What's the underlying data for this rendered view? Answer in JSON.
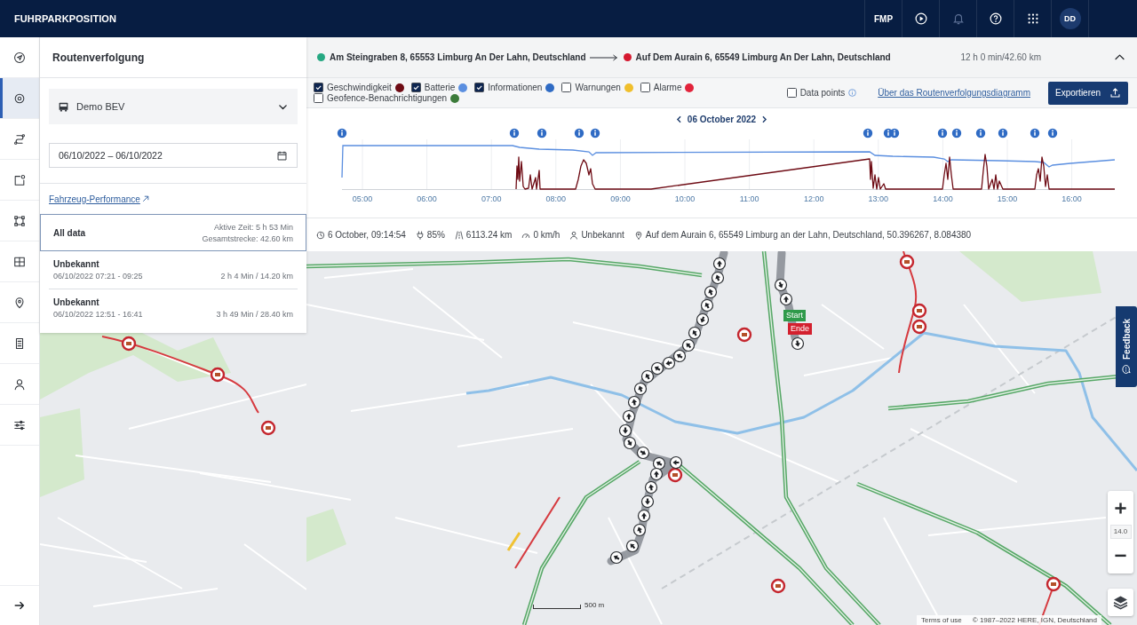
{
  "top_bar": {
    "logo": "FUHRPARKPOSITION",
    "account": "FMP",
    "avatar": "DD"
  },
  "nav_rail": {
    "items": [
      {
        "selected": false
      },
      {
        "selected": true
      },
      {
        "selected": false
      },
      {
        "selected": false
      },
      {
        "selected": false
      },
      {
        "selected": false
      },
      {
        "selected": false
      },
      {
        "selected": false
      },
      {
        "selected": false
      },
      {
        "selected": false
      }
    ]
  },
  "panel": {
    "title": "Routenverfolgung",
    "vehicle": "Demo BEV",
    "date_range": "06/10/2022 – 06/10/2022",
    "performance_link": "Fahrzeug-Performance",
    "trips": [
      {
        "kind": "summary",
        "title": "All data",
        "lines": [
          "Aktive Zeit: 5 h 53 Min",
          "Gesamtstrecke: 42.60 km"
        ],
        "selected": true
      },
      {
        "kind": "trip",
        "title": "Unbekannt",
        "period": "06/10/2022 07:21 - 09:25",
        "summary": "2 h 4 Min / 14.20 km",
        "selected": false
      },
      {
        "kind": "trip",
        "title": "Unbekannt",
        "period": "06/10/2022 12:51 - 16:41",
        "summary": "3 h 49 Min / 28.40 km",
        "selected": false
      }
    ]
  },
  "route": {
    "start": {
      "address": "Am Steingraben 8, 65553 Limburg An Der Lahn, Deutschland",
      "color": "#26a882"
    },
    "end": {
      "address": "Auf Dem Aurain 6, 65549 Limburg An Der Lahn, Deutschland",
      "color": "#d5182f"
    },
    "summary": "12 h 0 min/42.60 km",
    "expanded": true
  },
  "legend": {
    "series": [
      {
        "label": "Geschwindigkeit",
        "checked": true,
        "color": "#6e0b14"
      },
      {
        "label": "Batterie",
        "checked": true,
        "color": "#5b8fe0"
      },
      {
        "label": "Informationen",
        "checked": true,
        "color": "#2f6bc4"
      },
      {
        "label": "Warnungen",
        "checked": false,
        "color": "#f0bf2c"
      },
      {
        "label": "Alarme",
        "checked": false,
        "color": "#e2233b"
      },
      {
        "label": "Geofence-Benachrichtigungen",
        "checked": false,
        "color": "#3c7b3a"
      }
    ],
    "data_points": {
      "label": "Data points",
      "checked": false
    },
    "help_link": "Über das Routenverfolgungsdiagramm",
    "export_button": "Exportieren"
  },
  "chart": {
    "date": "06 October 2022",
    "time_labels": [
      "05:00",
      "06:00",
      "07:00",
      "08:00",
      "09:00",
      "10:00",
      "11:00",
      "12:00",
      "13:00",
      "14:00",
      "15:00",
      "16:00"
    ]
  },
  "status": [
    {
      "kind": "time",
      "text": "6 October, 09:14:54"
    },
    {
      "kind": "battery",
      "text": "85%"
    },
    {
      "kind": "odometer",
      "text": "6113.24 km"
    },
    {
      "kind": "speed",
      "text": "0 km/h"
    },
    {
      "kind": "driver",
      "text": "Unbekannt"
    },
    {
      "kind": "location",
      "text": "Auf dem Aurain 6, 65549 Limburg an der Lahn, Deutschland, 50.396267, 8.084380"
    }
  ],
  "map": {
    "markers": [
      {
        "kind": "start",
        "label": "Start"
      },
      {
        "kind": "end",
        "label": "Ende"
      }
    ],
    "feedback": "Feedback",
    "zoom_level": "14.0",
    "scale": "500 m",
    "attribution": [
      "Terms of use",
      "© 1987–2022 HERE, IGN, Deutschland"
    ]
  }
}
